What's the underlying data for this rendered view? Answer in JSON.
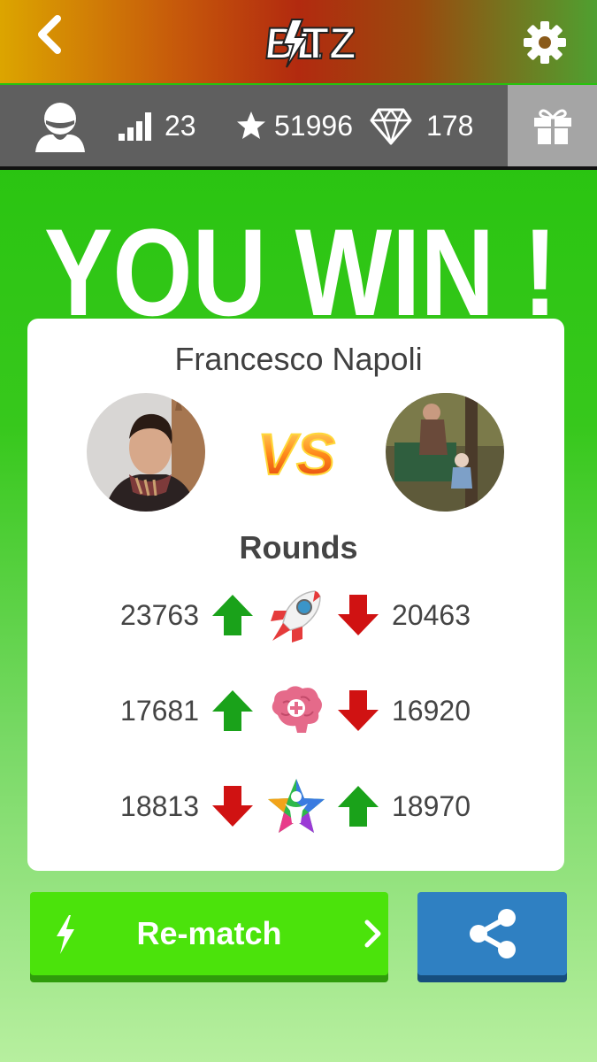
{
  "app": {
    "logo_text": "BLITZ"
  },
  "stats": {
    "level": "23",
    "stars": "51996",
    "gems": "178"
  },
  "result": {
    "title": "YOU WIN !"
  },
  "match": {
    "opponent_name": "Francesco Napoli",
    "rounds_title": "Rounds"
  },
  "rounds": [
    {
      "left_score": "23763",
      "left_trend": "up",
      "right_score": "20463",
      "right_trend": "down",
      "category_icon": "rocket-icon"
    },
    {
      "left_score": "17681",
      "left_trend": "up",
      "right_score": "16920",
      "right_trend": "down",
      "category_icon": "brain-icon"
    },
    {
      "left_score": "18813",
      "left_trend": "down",
      "right_score": "18970",
      "right_trend": "up",
      "category_icon": "star-person-icon"
    }
  ],
  "actions": {
    "rematch_label": "Re-match"
  },
  "icons": [
    "back-icon",
    "gear-icon",
    "user-icon",
    "signal-icon",
    "star-icon",
    "diamond-icon",
    "gift-icon",
    "bolt-icon",
    "chevron-right-icon",
    "share-icon"
  ],
  "colors": {
    "win_green": "#22c20a",
    "up_arrow": "#1aa21a",
    "down_arrow": "#d01212",
    "share_blue": "#2f80c2",
    "rematch_green": "#4be30b"
  }
}
